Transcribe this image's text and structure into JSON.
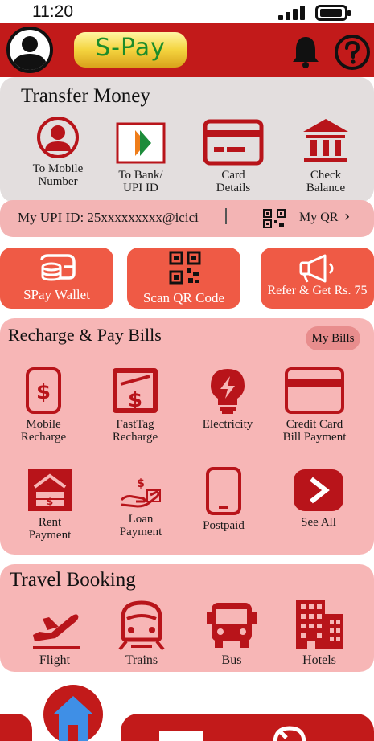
{
  "status_bar": {
    "time": "11:20"
  },
  "header": {
    "brand": "S-Pay"
  },
  "transfer": {
    "title": "Transfer Money",
    "items": [
      {
        "label_line1": "To Mobile",
        "label_line2": "Number",
        "icon": "person-circle-icon"
      },
      {
        "label_line1": "To Bank/",
        "label_line2": "UPI ID",
        "icon": "bank-upi-icon"
      },
      {
        "label_line1": "Card",
        "label_line2": "Details",
        "icon": "credit-card-icon"
      },
      {
        "label_line1": "Check",
        "label_line2": "Balance",
        "icon": "bank-building-icon"
      }
    ]
  },
  "upi": {
    "id_text": "My UPI ID: 25xxxxxxxxx@icici",
    "separator": "|",
    "myqr_label": "My QR",
    "chevron": "›"
  },
  "actions": [
    {
      "label": "SPay Wallet",
      "icon": "wallet-icon"
    },
    {
      "label": "Scan QR Code",
      "icon": "qr-code-icon"
    },
    {
      "label": "Refer & Get Rs. 75",
      "icon": "megaphone-icon"
    }
  ],
  "bills": {
    "title": "Recharge & Pay Bills",
    "my_bills_label": "My Bills",
    "items": [
      {
        "label_line1": "Mobile",
        "label_line2": "Recharge",
        "icon": "mobile-dollar-icon"
      },
      {
        "label_line1": "FastTag",
        "label_line2": "Recharge",
        "icon": "fasttag-icon"
      },
      {
        "label_line1": "Electricity",
        "label_line2": "",
        "icon": "bulb-bolt-icon"
      },
      {
        "label_line1": "Credit Card",
        "label_line2": "Bill Payment",
        "icon": "credit-card-icon"
      },
      {
        "label_line1": "Rent",
        "label_line2": "Payment",
        "icon": "house-money-icon"
      },
      {
        "label_line1": "Loan",
        "label_line2": "Payment",
        "icon": "hand-dollar-icon"
      },
      {
        "label_line1": "Postpaid",
        "label_line2": "",
        "icon": "phone-icon"
      },
      {
        "label_line1": "See All",
        "label_line2": "",
        "icon": "chevron-right-icon"
      }
    ]
  },
  "travel": {
    "title": "Travel Booking",
    "items": [
      {
        "label": "Flight",
        "icon": "plane-icon"
      },
      {
        "label": "Trains",
        "icon": "train-icon"
      },
      {
        "label": "Bus",
        "icon": "bus-icon"
      },
      {
        "label": "Hotels",
        "icon": "hotel-icon"
      }
    ]
  },
  "colors": {
    "brand_red": "#c21a1a",
    "action_orange": "#ef5a45",
    "card_pink": "#f7b6b6",
    "card_grey": "#e3dede",
    "icon_red": "#b8141a",
    "home_icon_blue": "#3f8fe6"
  }
}
